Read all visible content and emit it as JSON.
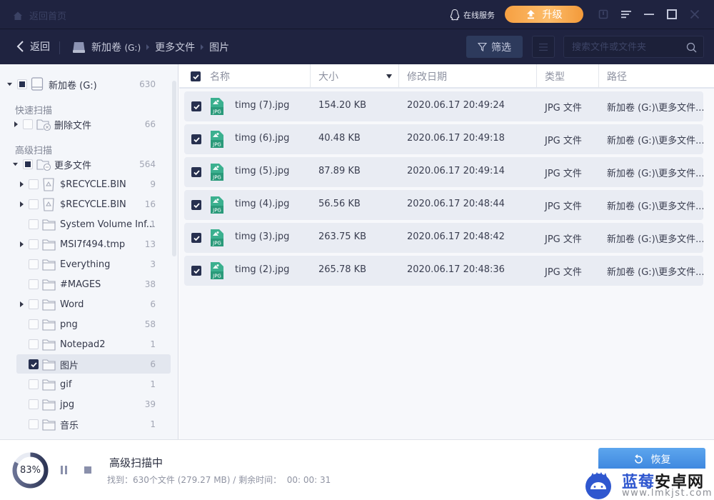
{
  "titlebar": {
    "home_label": "返回首页",
    "online_service": "在线服务",
    "upgrade_label": "升级",
    "icons": [
      "home-icon",
      "qq-penguin-icon",
      "upload-arrow-icon",
      "feedback-icon",
      "menu-icon",
      "minimize-icon",
      "maximize-icon",
      "close-icon"
    ]
  },
  "navbar": {
    "back_label": "返回",
    "breadcrumb": [
      {
        "label": "新加卷",
        "suffix": "(G:)"
      },
      {
        "label": "更多文件"
      },
      {
        "label": "图片"
      }
    ],
    "filter_label": "筛选",
    "search_placeholder": "搜索文件或文件夹",
    "search_value": ""
  },
  "sidebar": {
    "root": {
      "label": "新加卷 (G:)",
      "count": "630",
      "state": "partial",
      "expanded": true
    },
    "sections": [
      {
        "title": "快速扫描",
        "items": [
          {
            "label": "删除文件",
            "count": "66",
            "state": "unchecked",
            "expandable": true,
            "expanded": false,
            "icon": "deleted-folder-icon"
          }
        ]
      },
      {
        "title": "高级扫描",
        "items": [
          {
            "label": "更多文件",
            "count": "564",
            "state": "partial",
            "expandable": true,
            "expanded": true,
            "icon": "more-files-folder-icon"
          }
        ]
      }
    ],
    "children": [
      {
        "label": "$RECYCLE.BIN",
        "count": "9",
        "state": "unchecked",
        "expandable": true,
        "icon": "recycle-bin-icon"
      },
      {
        "label": "$RECYCLE.BIN",
        "count": "16",
        "state": "unchecked",
        "expandable": true,
        "icon": "recycle-bin-icon"
      },
      {
        "label": "System Volume Inf...",
        "count": "1",
        "state": "unchecked",
        "expandable": false,
        "icon": "folder-icon"
      },
      {
        "label": "MSI7f494.tmp",
        "count": "13",
        "state": "unchecked",
        "expandable": true,
        "icon": "folder-icon"
      },
      {
        "label": "Everything",
        "count": "3",
        "state": "unchecked",
        "expandable": false,
        "icon": "folder-icon"
      },
      {
        "label": "#MAGES",
        "count": "38",
        "state": "unchecked",
        "expandable": false,
        "icon": "folder-icon"
      },
      {
        "label": "Word",
        "count": "6",
        "state": "unchecked",
        "expandable": true,
        "icon": "folder-icon"
      },
      {
        "label": "png",
        "count": "58",
        "state": "unchecked",
        "expandable": false,
        "icon": "folder-icon"
      },
      {
        "label": "Notepad2",
        "count": "1",
        "state": "unchecked",
        "expandable": false,
        "icon": "folder-icon"
      },
      {
        "label": "图片",
        "count": "6",
        "state": "checked",
        "expandable": false,
        "selected": true,
        "icon": "folder-icon"
      },
      {
        "label": "gif",
        "count": "1",
        "state": "unchecked",
        "expandable": false,
        "icon": "folder-icon"
      },
      {
        "label": "jpg",
        "count": "39",
        "state": "unchecked",
        "expandable": false,
        "icon": "folder-icon"
      },
      {
        "label": "音乐",
        "count": "1",
        "state": "unchecked",
        "expandable": false,
        "icon": "folder-icon"
      }
    ]
  },
  "table": {
    "select_all_checked": true,
    "columns": [
      "名称",
      "大小",
      "修改日期",
      "类型",
      "路径"
    ],
    "sorted_column": "大小",
    "sort_direction": "descending",
    "rows": [
      {
        "checked": true,
        "name": "timg (7).jpg",
        "size": "154.20 KB",
        "modified": "2020.06.17 20:49:24",
        "type": "JPG 文件",
        "path": "新加卷 (G:)\\更多文件..."
      },
      {
        "checked": true,
        "name": "timg (6).jpg",
        "size": "40.48 KB",
        "modified": "2020.06.17 20:49:18",
        "type": "JPG 文件",
        "path": "新加卷 (G:)\\更多文件..."
      },
      {
        "checked": true,
        "name": "timg (5).jpg",
        "size": "87.89 KB",
        "modified": "2020.06.17 20:49:14",
        "type": "JPG 文件",
        "path": "新加卷 (G:)\\更多文件..."
      },
      {
        "checked": true,
        "name": "timg (4).jpg",
        "size": "56.56 KB",
        "modified": "2020.06.17 20:48:44",
        "type": "JPG 文件",
        "path": "新加卷 (G:)\\更多文件..."
      },
      {
        "checked": true,
        "name": "timg (3).jpg",
        "size": "263.75 KB",
        "modified": "2020.06.17 20:48:42",
        "type": "JPG 文件",
        "path": "新加卷 (G:)\\更多文件..."
      },
      {
        "checked": true,
        "name": "timg (2).jpg",
        "size": "265.78 KB",
        "modified": "2020.06.17 20:48:36",
        "type": "JPG 文件",
        "path": "新加卷 (G:)\\更多文件..."
      }
    ],
    "file_icon_label": "JPG"
  },
  "status": {
    "progress_percent": 83,
    "progress_label": "83%",
    "title": "高级扫描中",
    "info": "找到：630个文件 (279.27 MB) / 剩余时间：  00: 00: 31",
    "recover_label": "恢复"
  },
  "watermark": {
    "title_blue": "蓝莓",
    "title_dark": "安卓网",
    "url": "www.lmkjst.com"
  },
  "colors": {
    "titlebar_bg": "#1f2340",
    "upgrade_orange": "#f6a042",
    "checkbox_dark": "#27304f",
    "row_bg": "#e9ecf3",
    "recover_blue": "#3d86de",
    "jpg_icon_green": "#3bb08f",
    "watermark_blue": "#2f57cf"
  }
}
